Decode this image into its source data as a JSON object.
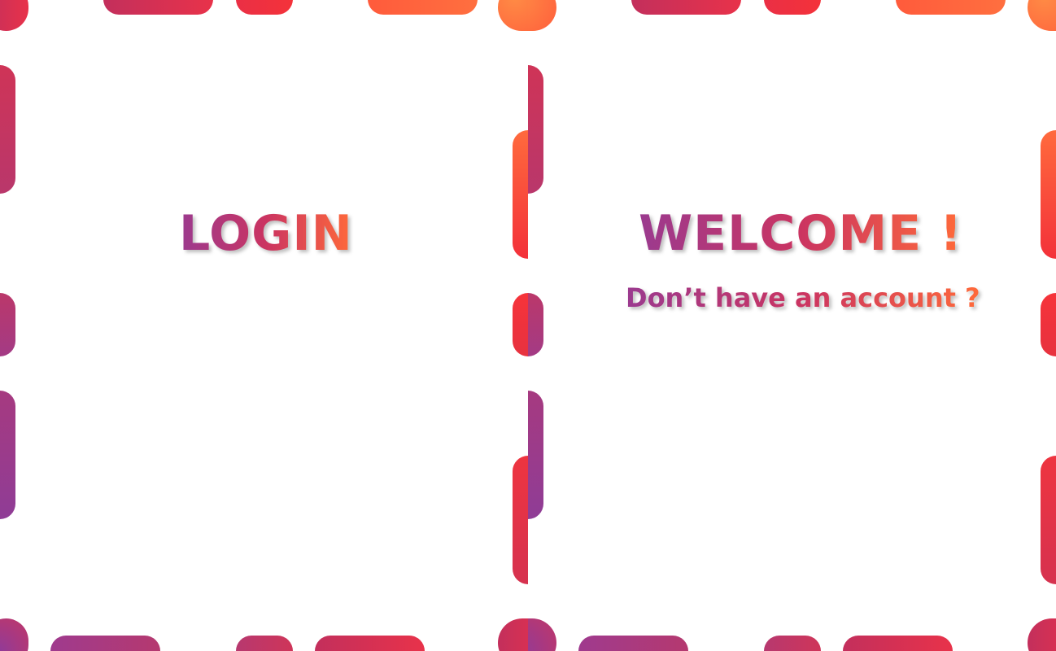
{
  "login_panel": {
    "title": "LOGIN"
  },
  "welcome_panel": {
    "title": "WELCOME !",
    "subtitle": "Don’t have an account ?"
  },
  "colors": {
    "gradient_start": "#9b3a8f",
    "gradient_mid": "#cb3461",
    "gradient_end": "#ff6a3a",
    "background": "#ffffff"
  }
}
